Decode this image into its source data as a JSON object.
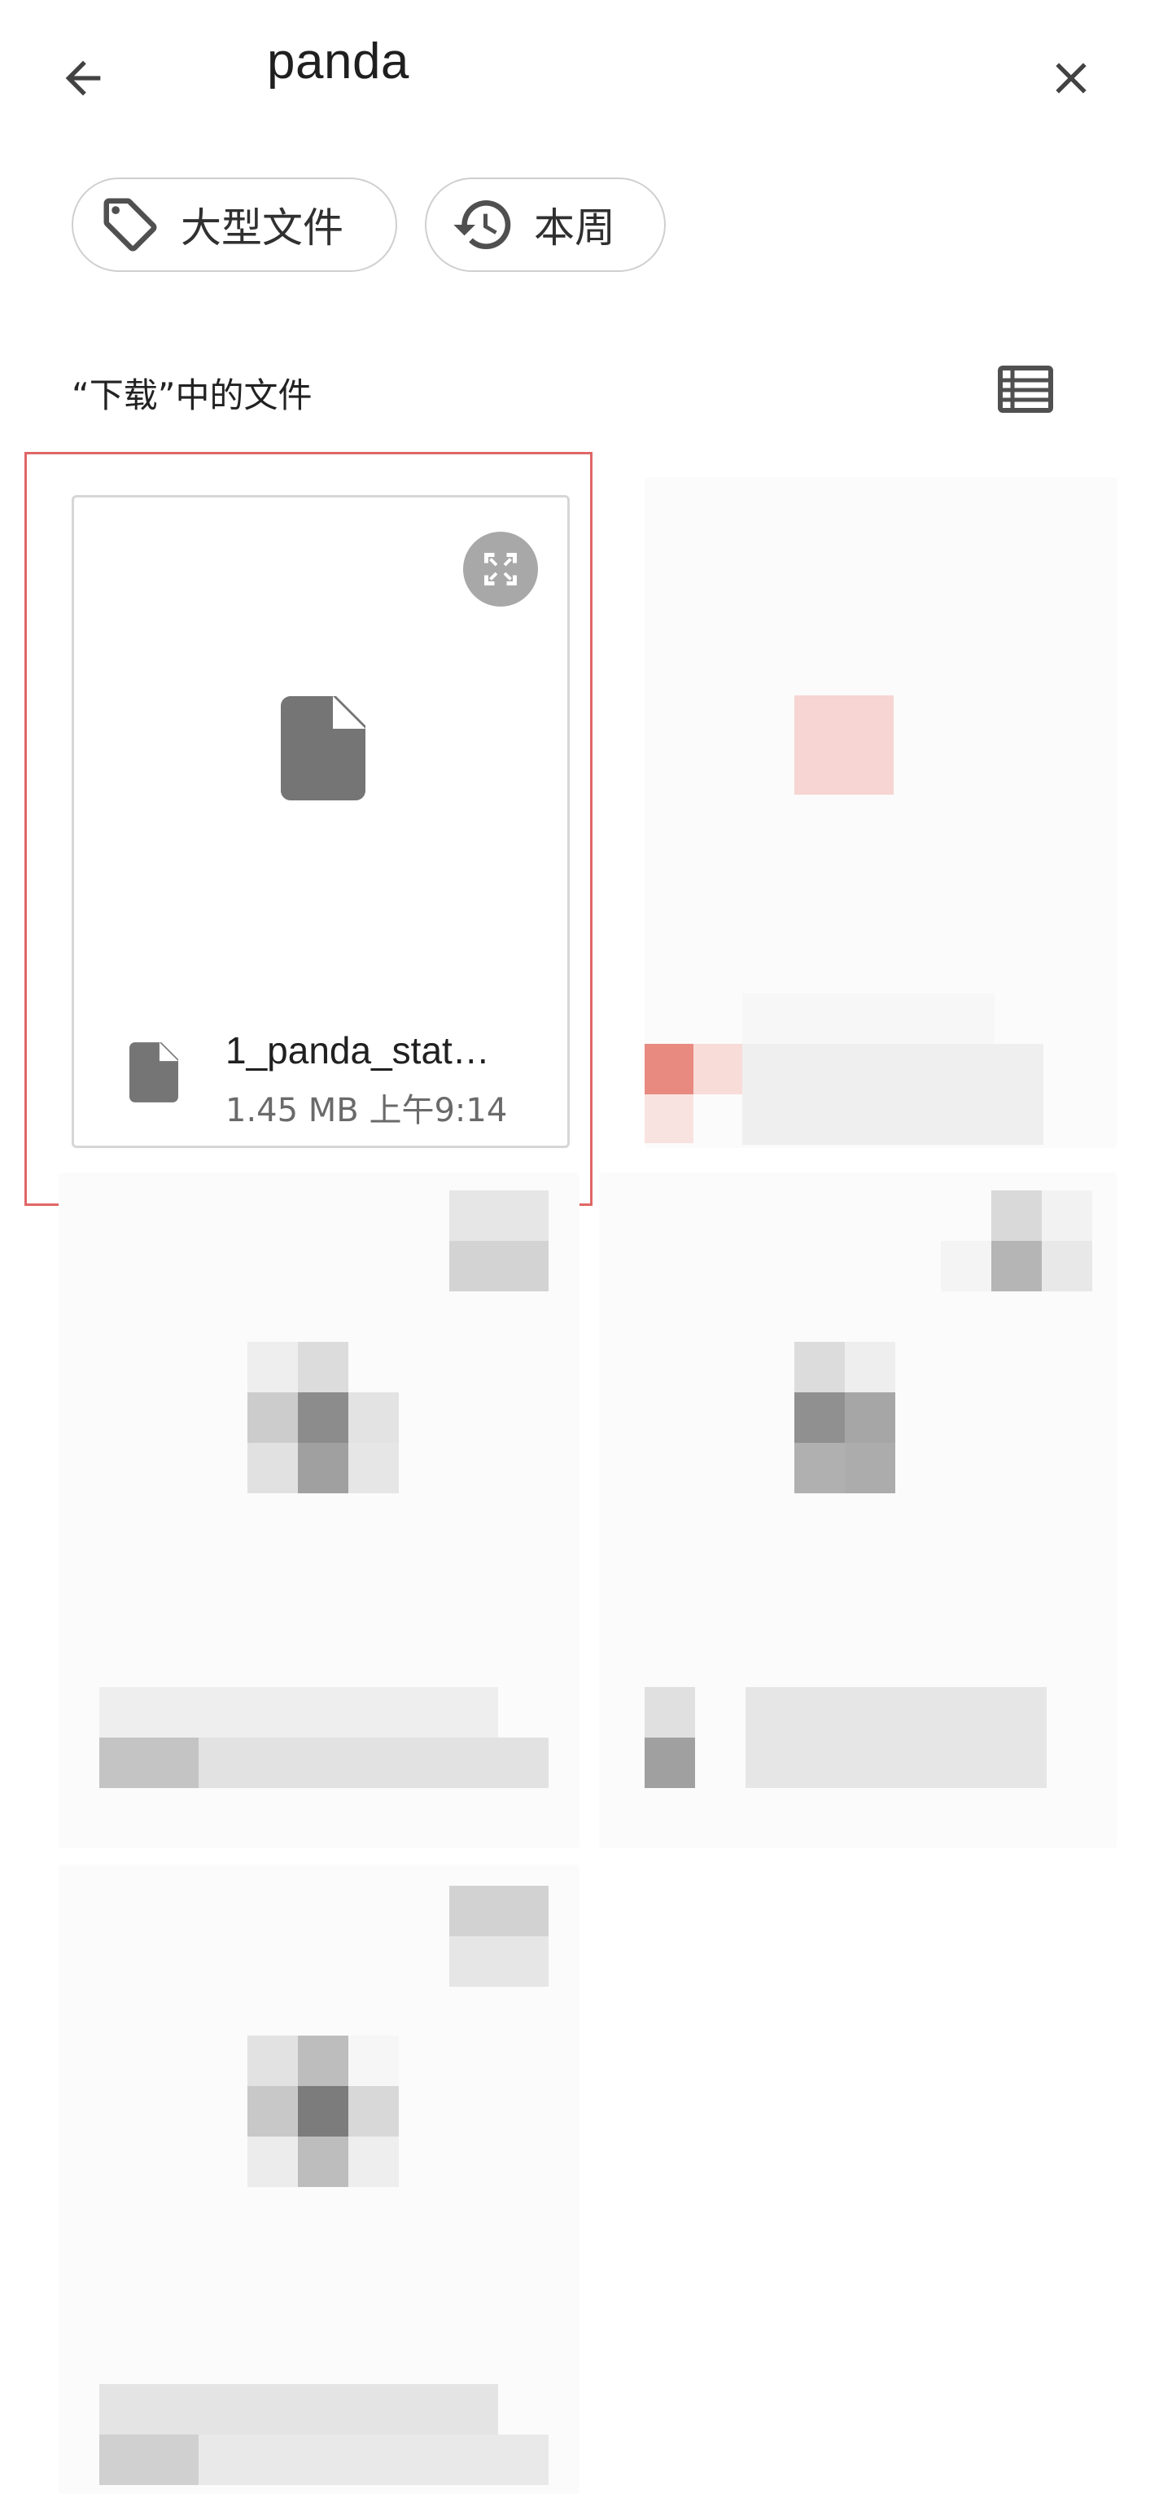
{
  "top_bar": {
    "back_icon": "arrow-back-icon",
    "search_query": "panda",
    "close_icon": "close-icon"
  },
  "filters": {
    "large_files": {
      "label": "大型文件",
      "icon": "tag-icon"
    },
    "this_week": {
      "label": "本周",
      "icon": "history-icon"
    }
  },
  "section": {
    "title": "“下载”中的文件",
    "view_toggle_icon": "list-view-icon"
  },
  "files": [
    {
      "name": "1_panda_stat…",
      "size": "1.45 MB",
      "time": "上午9:14",
      "meta": "1.45 MB 上午9:14",
      "icon": "document-icon",
      "expand_icon": "fullscreen-icon"
    }
  ],
  "colors": {
    "highlight": "#e06666",
    "icon_gray": "#757575",
    "chip_border": "#cfcfcf"
  }
}
